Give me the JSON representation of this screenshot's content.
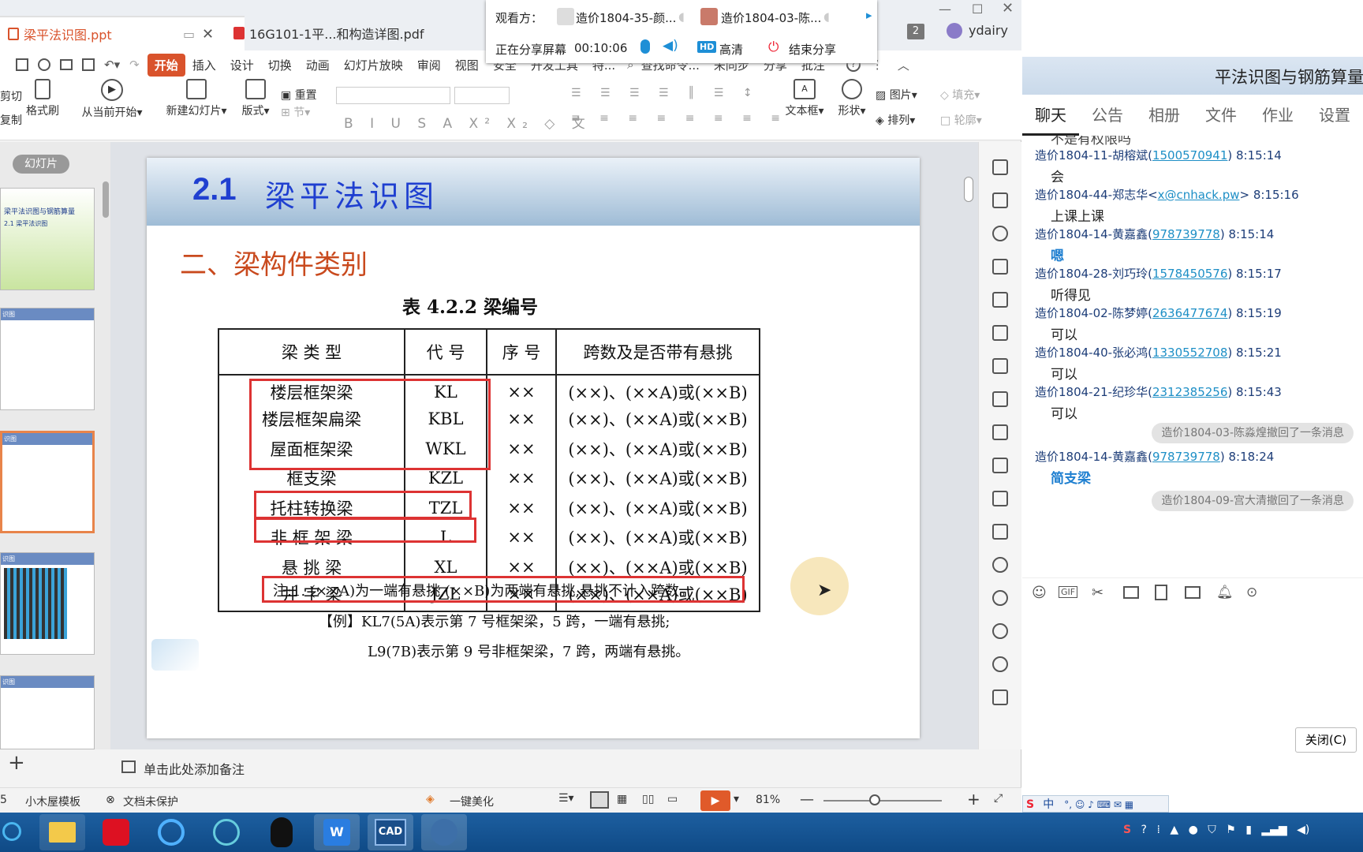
{
  "tabs": {
    "ppt": "梁平法识图.ppt",
    "pdf": "16G101-1平...和构造详图.pdf",
    "win_count": "2",
    "user": "ydairy"
  },
  "share": {
    "viewer_label": "观看方：",
    "viewer1": "造价1804-35-颜...",
    "viewer2": "造价1804-03-陈...",
    "status": "正在分享屏幕",
    "time": "00:10:06",
    "hd_badge": "HD",
    "hd": "高清",
    "end": "结束分享"
  },
  "menu": [
    "开始",
    "插入",
    "设计",
    "切换",
    "动画",
    "幻灯片放映",
    "审阅",
    "视图",
    "安全",
    "开发工具",
    "特...",
    "查找命令...",
    "未同步",
    "分享",
    "批注"
  ],
  "ribbon": {
    "cut": "剪切",
    "copy": "复制",
    "format_painter": "格式刷",
    "from_current": "从当前开始",
    "new_slide": "新建幻灯片",
    "layout": "版式",
    "reset": "重置",
    "section": "节",
    "textbox": "文本框",
    "shape": "形状",
    "picture": "图片",
    "fill": "填充",
    "arrange": "排列",
    "outline": "轮廓"
  },
  "panel": {
    "slides_tab": "幻灯片"
  },
  "thumbs": {
    "t1_line1": "梁平法识图与钢筋算量",
    "t1_line2": "2.1  梁平法识图",
    "t2_head": "识图",
    "t3_head": "识图",
    "t4_head": "识图",
    "t5_head": "识图"
  },
  "slide": {
    "number": "2.1",
    "title": "梁平法识图",
    "subtitle": "二、梁构件类别",
    "table_caption": "表 4.2.2   梁编号",
    "headers": [
      "梁 类 型",
      "代 号",
      "序 号",
      "跨数及是否带有悬挑"
    ],
    "rows": [
      [
        "楼层框架梁",
        "KL",
        "××",
        "(××)、(××A)或(××B)"
      ],
      [
        "楼层框架扁梁",
        "KBL",
        "××",
        "(××)、(××A)或(××B)"
      ],
      [
        "屋面框架梁",
        "WKL",
        "××",
        "(××)、(××A)或(××B)"
      ],
      [
        "框支梁",
        "KZL",
        "××",
        "(××)、(××A)或(××B)"
      ],
      [
        "托柱转换梁",
        "TZL",
        "××",
        "(××)、(××A)或(××B)"
      ],
      [
        "非 框 架 梁",
        "L",
        "××",
        "(××)、(××A)或(××B)"
      ],
      [
        "悬  挑  梁",
        "XL",
        "××",
        "(××)、(××A)或(××B)"
      ],
      [
        "井  字  梁",
        "JZL",
        "××",
        "(××)、(××A)或(××B)"
      ]
    ],
    "note": "注:1. (××A)为一端有悬挑,(××B)为两端有悬挑,悬挑不计入跨数。",
    "example1": "【例】KL7(5A)表示第 7 号框架梁，5 跨，一端有悬挑;",
    "example2": "L9(7B)表示第 9 号非框架梁，7 跨，两端有悬挑。"
  },
  "notes_placeholder": "单击此处添加备注",
  "status": {
    "page": "5",
    "template": "小木屋模板",
    "protect": "文档未保护",
    "beautify": "一键美化",
    "zoom": "81%"
  },
  "chat": {
    "title": "平法识图与钢筋算量",
    "tabs": [
      "聊天",
      "公告",
      "相册",
      "文件",
      "作业",
      "设置"
    ],
    "cut_top": "不是有权限吗",
    "messages": [
      {
        "name": "造价1804-11-胡榕斌(",
        "qq": "1500570941",
        "time": ") 8:15:14",
        "text": "会"
      },
      {
        "name": "造价1804-44-郑志华<",
        "qq": "x@cnhack.pw",
        "time": "> 8:15:16",
        "text": "上课上课"
      },
      {
        "name": "造价1804-14-黄嘉鑫(",
        "qq": "978739778",
        "time": ") 8:15:14",
        "text": "嗯"
      },
      {
        "name": "造价1804-28-刘巧玲(",
        "qq": "1578450576",
        "time": ") 8:15:17",
        "text": "听得见"
      },
      {
        "name": "造价1804-02-陈梦婷(",
        "qq": "2636477674",
        "time": ") 8:15:19",
        "text": "可以"
      },
      {
        "name": "造价1804-40-张必鸿(",
        "qq": "1330552708",
        "time": ") 8:15:21",
        "text": "可以"
      },
      {
        "name": "造价1804-21-纪珍华(",
        "qq": "2312385256",
        "time": ") 8:15:43",
        "text": "可以"
      },
      {
        "name": "造价1804-14-黄嘉鑫(",
        "qq": "978739778",
        "time": ") 8:18:24",
        "text": "简支梁"
      }
    ],
    "recall1": "造价1804-03-陈淼煌撤回了一条消息",
    "recall2": "造价1804-09-宫大清撤回了一条消息",
    "close": "关闭(C)",
    "ime": "中"
  }
}
